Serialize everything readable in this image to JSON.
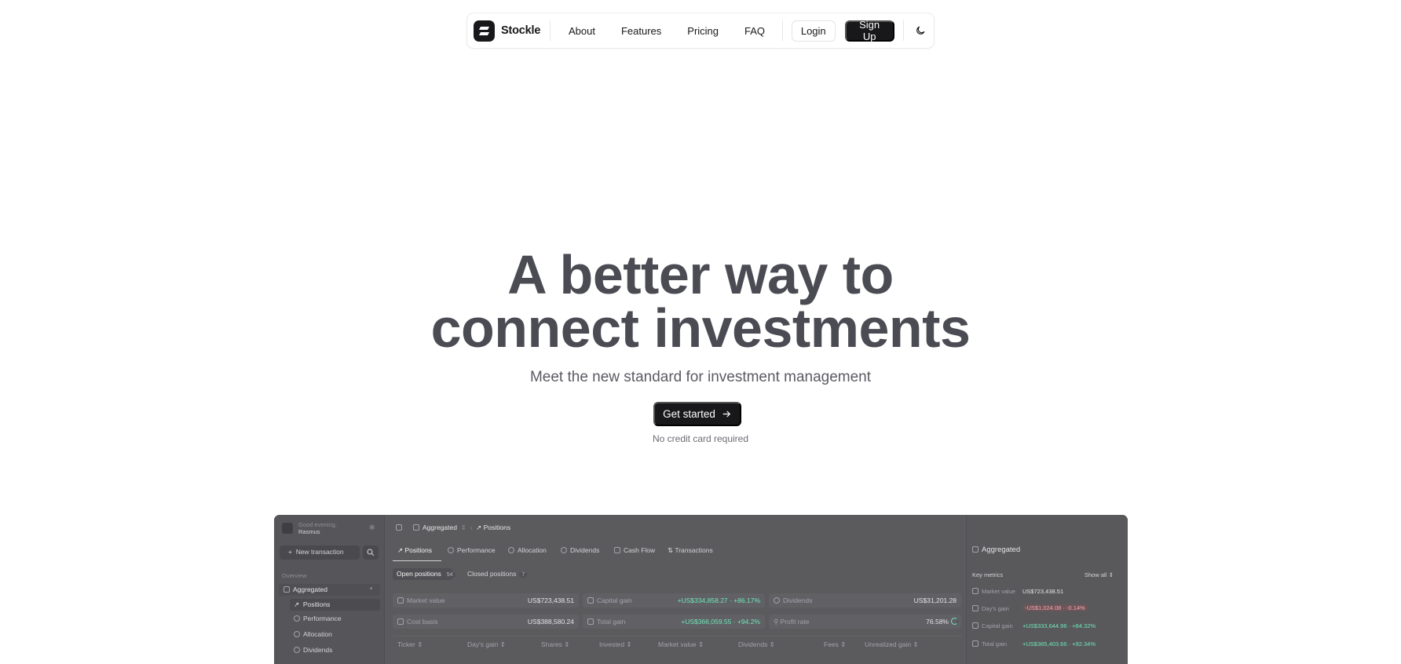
{
  "nav": {
    "brand": "Stockle",
    "links": [
      "About",
      "Features",
      "Pricing",
      "FAQ"
    ],
    "login": "Login",
    "signup": "Sign Up"
  },
  "hero": {
    "title_line1": "A better way to",
    "title_line2": "connect investments",
    "subtitle": "Meet the new standard for investment management",
    "cta": "Get started",
    "note": "No credit card required"
  },
  "preview": {
    "greeting_line1": "Good evening,",
    "greeting_line2": "Rasmus",
    "new_transaction": "New transaction",
    "overview": "Overview",
    "portfolio": "Aggregated",
    "sidebar_items": [
      "Positions",
      "Performance",
      "Allocation",
      "Dividends"
    ],
    "breadcrumb_portfolio": "Aggregated",
    "breadcrumb_page": "Positions",
    "tabs": [
      "Positions",
      "Performance",
      "Allocation",
      "Dividends",
      "Cash Flow",
      "Transactions"
    ],
    "open_positions": "Open positions",
    "open_count": "54",
    "closed_positions": "Closed positions",
    "closed_count": "7",
    "metrics": {
      "market_value_label": "Market value",
      "market_value": "US$723,438.51",
      "capital_gain_label": "Capital gain",
      "capital_gain": "+US$334,858.27 · +86.17%",
      "dividends_label": "Dividends",
      "dividends": "US$31,201.28",
      "cost_basis_label": "Cost basis",
      "cost_basis": "US$388,580.24",
      "total_gain_label": "Total gain",
      "total_gain": "+US$366,059.55 · +94.2%",
      "profit_rate_label": "Profit rate",
      "profit_rate": "76.58%"
    },
    "columns": [
      "Ticker",
      "Day's gain",
      "Shares",
      "Invested",
      "Market value",
      "Dividends",
      "Fees",
      "Unrealized gain"
    ],
    "right_panel": {
      "title": "Aggregated",
      "key_metrics": "Key metrics",
      "show_all": "Show all",
      "rows": [
        {
          "label": "Market value",
          "value": "US$723,438.51",
          "tone": "normal"
        },
        {
          "label": "Day's gain",
          "value": "-US$1,024.08 · -0.14%",
          "tone": "red"
        },
        {
          "label": "Capital gain",
          "value": "+US$333,644.96 · +84.32%",
          "tone": "green"
        },
        {
          "label": "Total gain",
          "value": "+US$365,403.66 · +92.34%",
          "tone": "green"
        }
      ]
    }
  }
}
